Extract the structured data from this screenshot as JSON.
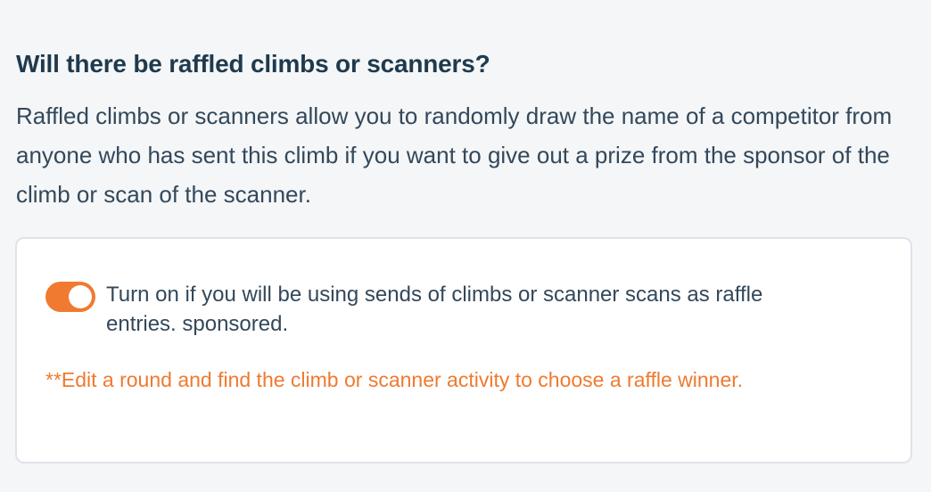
{
  "section": {
    "heading": "Will there be raffled climbs or scanners?",
    "description": "Raffled climbs or scanners allow you to randomly draw the name of a competitor from anyone who has sent this climb if you want to give out a prize from the sponsor of the climb or scan of the scanner."
  },
  "raffle_card": {
    "toggle": {
      "state": "on",
      "label": "Turn on if you will be using sends of climbs or scanner scans as raffle entries. sponsored."
    },
    "note": "**Edit a round and find the climb or scanner activity to choose a raffle winner."
  },
  "colors": {
    "accent": "#f07a30",
    "heading_text": "#1f3a4d",
    "body_text": "#33485a",
    "note_text": "#ef7a2f",
    "page_background": "#f4f6f8",
    "card_border": "#dfe3e8"
  }
}
